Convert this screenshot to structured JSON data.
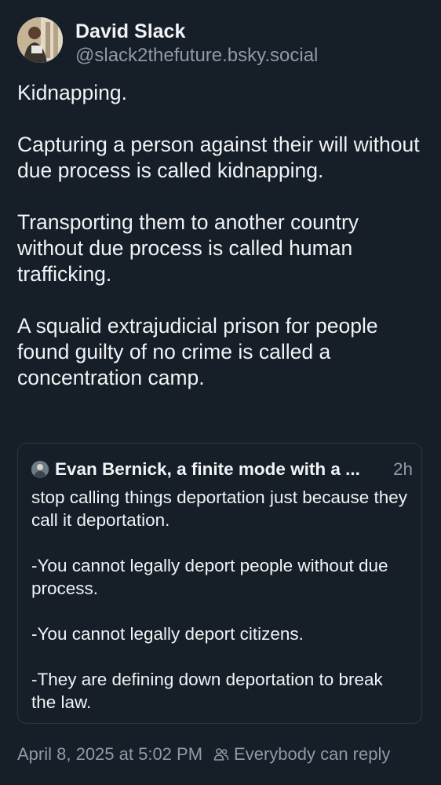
{
  "author": {
    "display_name": "David Slack",
    "handle": "@slack2thefuture.bsky.social",
    "avatar_icon": "person-portrait-avatar"
  },
  "post": {
    "paragraphs": [
      "Kidnapping.",
      "Capturing a person against their will without due process is called kidnapping.",
      "Transporting them to another country without due process is called human trafficking.",
      "A squalid extrajudicial prison for people found guilty of no crime is called a concentration camp."
    ]
  },
  "quote": {
    "author_name": "Evan Bernick, a finite mode with a ...",
    "time": "2h",
    "avatar_icon": "person-portrait-avatar",
    "paragraphs": [
      "stop calling things deportation just because they call it deportation.",
      "-You cannot legally deport people without due process.",
      "-You cannot legally deport citizens.",
      "-They are defining down deportation to break the law."
    ]
  },
  "footer": {
    "timestamp": "April 8, 2025 at 5:02 PM",
    "reply_setting": "Everybody can reply",
    "reply_icon": "people-icon"
  },
  "colors": {
    "background": "#161e27",
    "text": "#f1f3f5",
    "muted": "#8d9aa8",
    "border": "#2c3744"
  }
}
